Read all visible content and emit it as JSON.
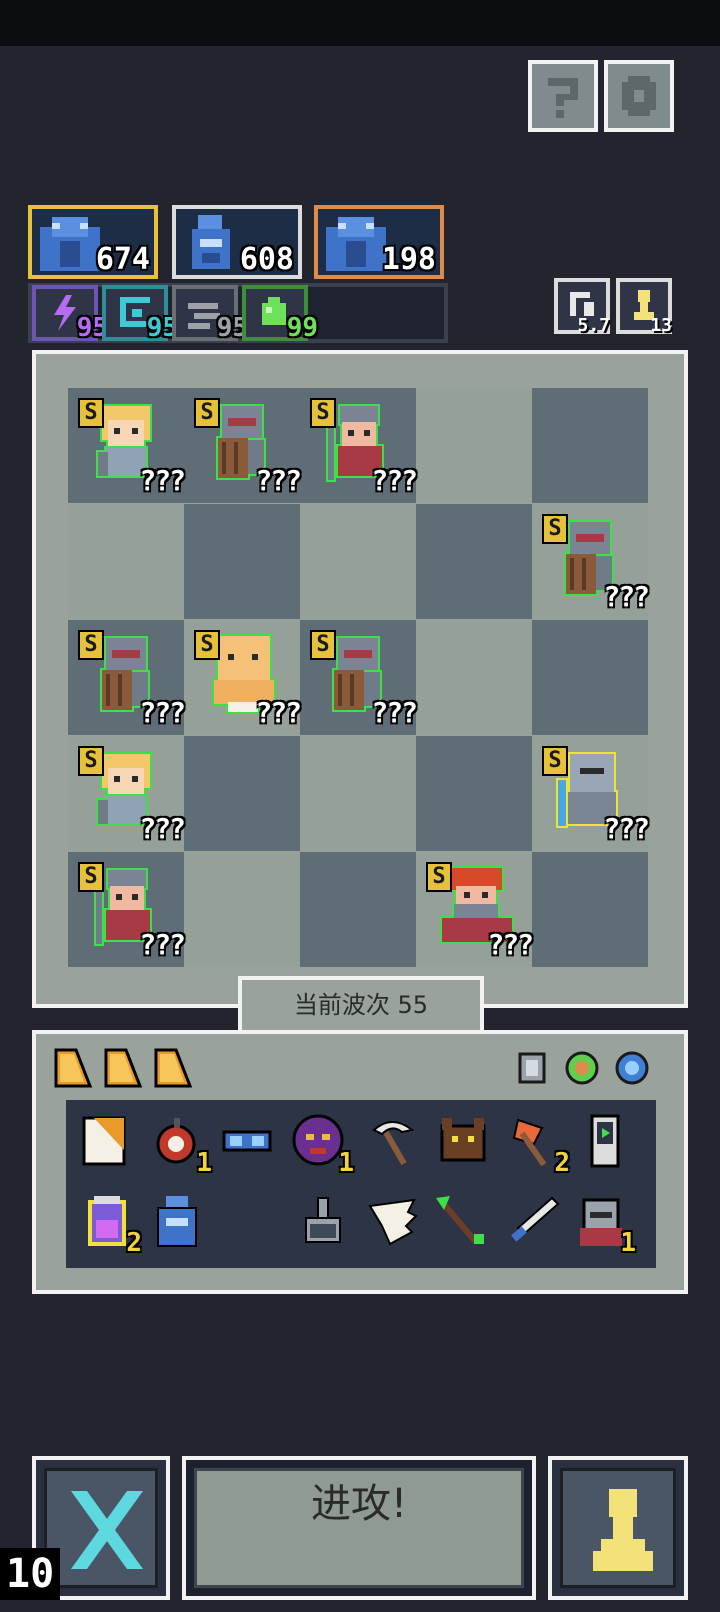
{
  "heroes": [
    {
      "count": "674",
      "color": "#e8c13a"
    },
    {
      "count": "608",
      "color": "#dcdcdc"
    },
    {
      "count": "198",
      "color": "#e08b4e"
    }
  ],
  "elements": [
    {
      "icon": "lightning-icon",
      "value": "95",
      "color": "#b56bf2"
    },
    {
      "icon": "swirl-icon",
      "value": "95",
      "color": "#3ec9d4"
    },
    {
      "icon": "wind-icon",
      "value": "95",
      "color": "#9ea2a8"
    },
    {
      "icon": "blob-icon",
      "value": "99",
      "color": "#6fe05b"
    }
  ],
  "counters": {
    "recycle": "5.7",
    "pawn": "13"
  },
  "board": {
    "rank": "S",
    "unknown": "???",
    "units": [
      {
        "row": 0,
        "col": 0,
        "type": "blonde-girl",
        "glow": "green"
      },
      {
        "row": 0,
        "col": 1,
        "type": "shield-knight",
        "glow": "green"
      },
      {
        "row": 0,
        "col": 2,
        "type": "spear-soldier",
        "glow": "green"
      },
      {
        "row": 1,
        "col": 4,
        "type": "shield-knight",
        "glow": "green"
      },
      {
        "row": 2,
        "col": 0,
        "type": "shield-knight",
        "glow": "green"
      },
      {
        "row": 2,
        "col": 1,
        "type": "bald-monk",
        "glow": "green"
      },
      {
        "row": 2,
        "col": 2,
        "type": "shield-knight",
        "glow": "green"
      },
      {
        "row": 3,
        "col": 0,
        "type": "blonde-girl",
        "glow": "green"
      },
      {
        "row": 3,
        "col": 4,
        "type": "armored-knight",
        "glow": "yellow"
      },
      {
        "row": 4,
        "col": 0,
        "type": "spear-soldier",
        "glow": "green"
      },
      {
        "row": 4,
        "col": 3,
        "type": "red-haired-dwarf",
        "glow": "green"
      }
    ]
  },
  "wave_label": "当前波次 55",
  "inventory": {
    "cards": [
      "card-icon",
      "card-icon",
      "card-icon"
    ],
    "gems": [
      "gray-gem-icon",
      "green-gem-icon",
      "blue-gem-icon"
    ],
    "items": [
      {
        "icon": "paper-icon",
        "count": ""
      },
      {
        "icon": "bomb-icon",
        "count": "1"
      },
      {
        "icon": "goggles-icon",
        "count": ""
      },
      {
        "icon": "demon-mask-icon",
        "count": "1"
      },
      {
        "icon": "scythe-icon",
        "count": ""
      },
      {
        "icon": "wolf-head-icon",
        "count": ""
      },
      {
        "icon": "axe-icon",
        "count": "2"
      },
      {
        "icon": "phone-icon",
        "count": ""
      },
      {
        "icon": "potion-jar-icon",
        "count": "2"
      },
      {
        "icon": "blue-hood-icon",
        "count": ""
      },
      {
        "icon": "anvil-icon",
        "count": ""
      },
      {
        "icon": "wing-icon",
        "count": ""
      },
      {
        "icon": "arrow-icon",
        "count": ""
      },
      {
        "icon": "dagger-icon",
        "count": ""
      },
      {
        "icon": "helmet-icon",
        "count": "1"
      }
    ]
  },
  "buttons": {
    "attack": "进攻!"
  },
  "level": "10"
}
